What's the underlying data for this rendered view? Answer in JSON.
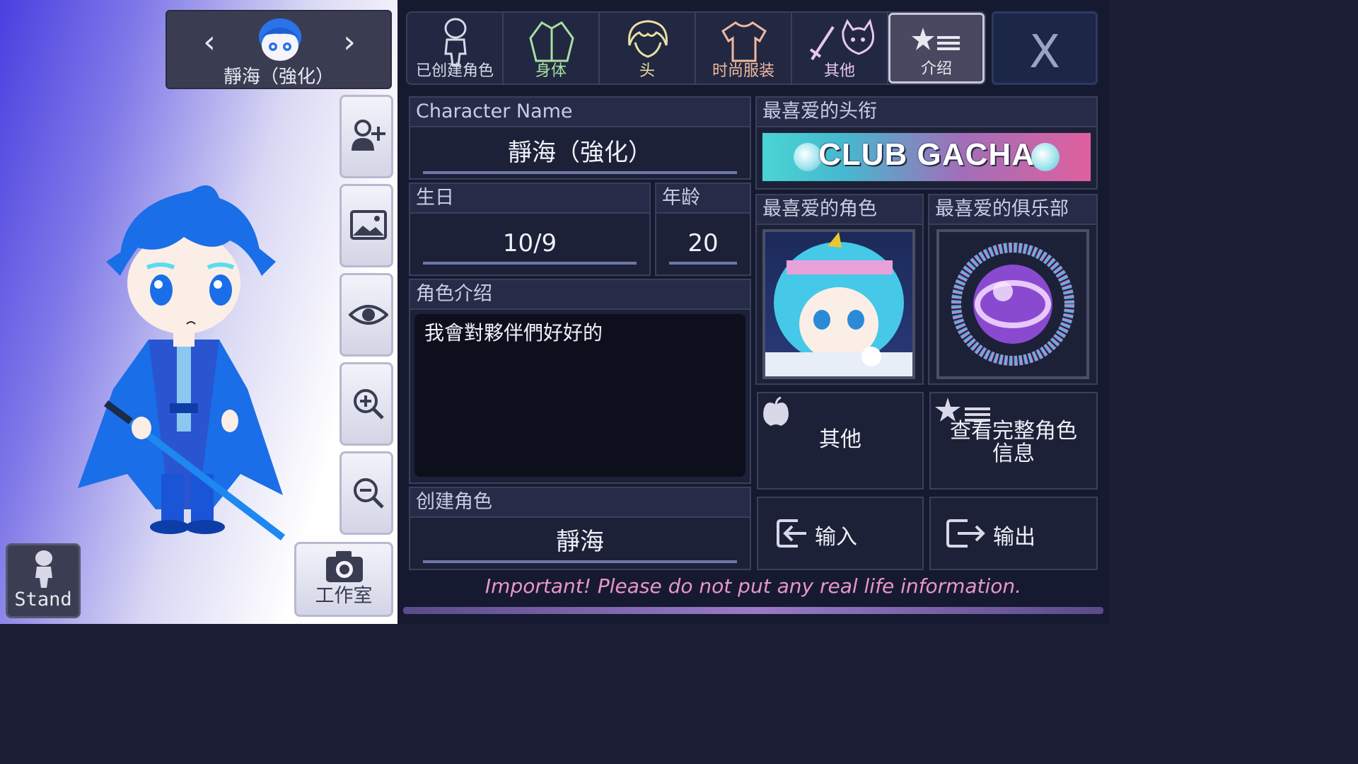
{
  "character_nav": {
    "name": "靜海（強化）",
    "prev_icon": "chevron-left-icon",
    "next_icon": "chevron-right-icon"
  },
  "side_tools": [
    {
      "name": "add-character-icon"
    },
    {
      "name": "background-image-icon"
    },
    {
      "name": "eye-icon"
    },
    {
      "name": "zoom-in-icon"
    },
    {
      "name": "zoom-out-icon"
    }
  ],
  "stand_button": {
    "label": "Stand"
  },
  "studio_button": {
    "label": "工作室",
    "icon": "camera-icon"
  },
  "tabs": [
    {
      "label": "已创建角色",
      "icon": "figure-icon",
      "color": "#d8d8e8"
    },
    {
      "label": "身体",
      "icon": "jacket-icon",
      "color": "#a8e0a0"
    },
    {
      "label": "头",
      "icon": "hair-icon",
      "color": "#e8e0a0"
    },
    {
      "label": "时尚服装",
      "icon": "shirt-icon",
      "color": "#f0b8a0"
    },
    {
      "label": "其他",
      "icon": "sword-cat-icon",
      "color": "#e8c8e8"
    },
    {
      "label": "介绍",
      "icon": "star-list-icon",
      "color": "#e8e8f0",
      "active": true
    }
  ],
  "close_button": {
    "label": "X"
  },
  "profile": {
    "name_header": "Character Name",
    "name_value": "靜海（強化）",
    "birthday_header": "生日",
    "birthday_value": "10/9",
    "age_header": "年龄",
    "age_value": "20",
    "intro_header": "角色介绍",
    "intro_value": "我會對夥伴們好好的",
    "creator_header": "创建角色",
    "creator_value": "靜海"
  },
  "favorites": {
    "title_header": "最喜爱的头衔",
    "title_value": "CLUB GACHA",
    "character_header": "最喜爱的角色",
    "club_header": "最喜爱的俱乐部"
  },
  "actions": {
    "other_label": "其他",
    "full_info_label": "查看完整角色信息",
    "import_label": "输入",
    "export_label": "输出"
  },
  "warning": "Important! Please do not put any real life information.",
  "colors": {
    "accent_blue": "#1a6ee8",
    "panel_bg": "#161a30",
    "warning_pink": "#e896c8"
  }
}
